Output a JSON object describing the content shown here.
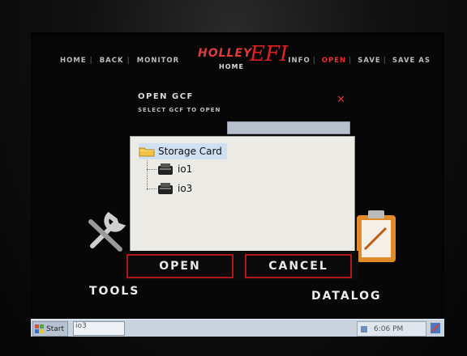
{
  "nav": {
    "home": "HOME",
    "back": "BACK",
    "monitor": "MONITOR",
    "info": "INFO",
    "open": "OPEN",
    "save": "SAVE",
    "save_as": "SAVE AS"
  },
  "logo": {
    "brand": "HOLLEY",
    "efi": "EFI",
    "subtitle": "HOME"
  },
  "dialog": {
    "title": "OPEN GCF",
    "subtitle": "SELECT GCF TO OPEN",
    "close_icon": "close-icon",
    "tree": {
      "root": {
        "label": "Storage Card",
        "icon": "folder-icon"
      },
      "children": [
        {
          "label": "io1",
          "icon": "device-icon"
        },
        {
          "label": "io3",
          "icon": "device-icon"
        }
      ]
    },
    "open_label": "OPEN",
    "cancel_label": "CANCEL"
  },
  "background": {
    "tools_label": "TOOLS",
    "datalog_label": "DATALOG"
  },
  "taskbar": {
    "start_label": "Start",
    "task_item": "io3",
    "time": "6:06 PM"
  },
  "colors": {
    "accent": "#e02020",
    "screen_bg": "#070707",
    "file_bg": "#ecebe5",
    "selection": "#cfe0f3",
    "taskbar": "#c9d3de"
  }
}
